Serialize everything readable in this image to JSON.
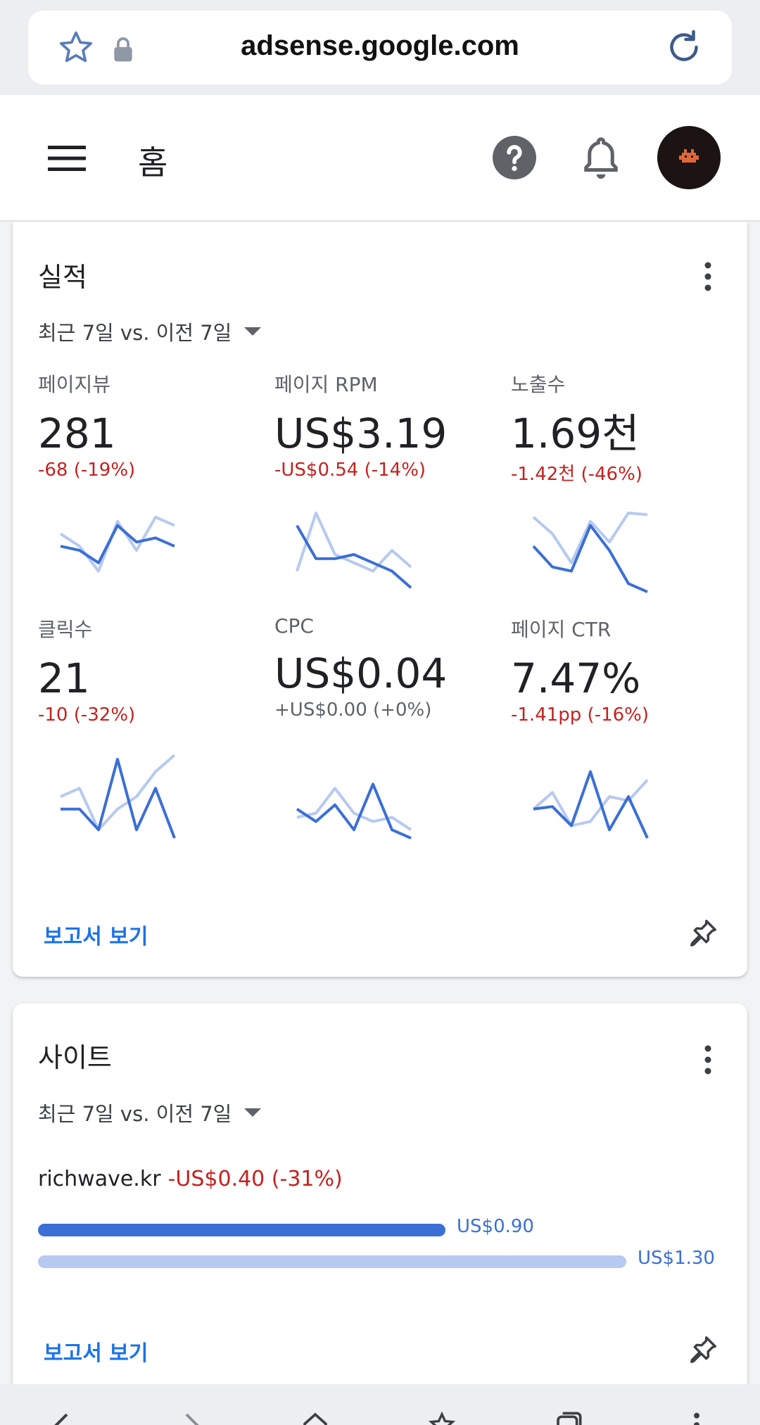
{
  "browser": {
    "url": "adsense.google.com"
  },
  "header": {
    "title": "홈"
  },
  "performance": {
    "title": "실적",
    "range": "최근 7일 vs. 이전 7일",
    "metrics": [
      {
        "label": "페이지뷰",
        "value": "281",
        "delta": "-68 (-19%)",
        "tone": "neg",
        "current": [
          0.6,
          0.55,
          0.4,
          0.85,
          0.65,
          0.7,
          0.6
        ],
        "previous": [
          0.75,
          0.6,
          0.3,
          0.9,
          0.55,
          0.95,
          0.85
        ]
      },
      {
        "label": "페이지 RPM",
        "value": "US$3.19",
        "delta": "-US$0.54 (-14%)",
        "tone": "neg",
        "current": [
          0.85,
          0.45,
          0.45,
          0.5,
          0.4,
          0.3,
          0.1
        ],
        "previous": [
          0.3,
          1.0,
          0.5,
          0.4,
          0.3,
          0.55,
          0.35
        ]
      },
      {
        "label": "노출수",
        "value": "1.69천",
        "delta": "-1.42천 (-46%)",
        "tone": "neg",
        "current": [
          0.6,
          0.35,
          0.3,
          0.85,
          0.55,
          0.15,
          0.05
        ],
        "previous": [
          0.95,
          0.75,
          0.4,
          0.9,
          0.65,
          1.0,
          0.98
        ]
      },
      {
        "label": "클릭수",
        "value": "21",
        "delta": "-10 (-32%)",
        "tone": "neg",
        "current": [
          0.35,
          0.35,
          0.1,
          0.95,
          0.1,
          0.6,
          0.0
        ],
        "previous": [
          0.5,
          0.6,
          0.1,
          0.35,
          0.5,
          0.8,
          1.0
        ]
      },
      {
        "label": "CPC",
        "value": "US$0.04",
        "delta": "+US$0.00 (+0%)",
        "tone": "neu",
        "current": [
          0.35,
          0.2,
          0.4,
          0.1,
          0.65,
          0.1,
          0.0
        ],
        "previous": [
          0.25,
          0.3,
          0.6,
          0.3,
          0.2,
          0.25,
          0.1
        ]
      },
      {
        "label": "페이지 CTR",
        "value": "7.47%",
        "delta": "-1.41pp (-16%)",
        "tone": "neg",
        "current": [
          0.35,
          0.38,
          0.15,
          0.8,
          0.1,
          0.5,
          0.0
        ],
        "previous": [
          0.35,
          0.55,
          0.15,
          0.2,
          0.5,
          0.45,
          0.7
        ]
      }
    ],
    "report_link": "보고서 보기"
  },
  "sites": {
    "title": "사이트",
    "range": "최근 7일 vs. 이전 7일",
    "site_name": "richwave.kr",
    "site_delta": "-US$0.40 (-31%)",
    "current_value": "US$0.90",
    "previous_value": "US$1.30",
    "current_amount": 0.9,
    "previous_amount": 1.3,
    "report_link": "보고서 보기"
  },
  "colors": {
    "accent": "#1a73e8",
    "series_current": "#3b6fd6",
    "series_previous": "#b6c9f0",
    "negative": "#c5221f"
  }
}
